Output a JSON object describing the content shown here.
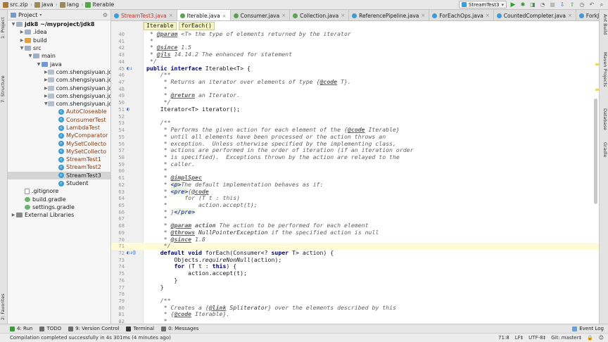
{
  "nav": {
    "crumbs": [
      "src.zip",
      "java",
      "lang",
      "Iterable"
    ],
    "run_config": "StreamTest3"
  },
  "left_toolbar": [
    "1: Project",
    "7: Structure",
    "2: Favorites"
  ],
  "right_toolbar": [
    "Ant Build",
    "Maven Projects",
    "Database",
    "Gradle"
  ],
  "project": {
    "title": "Project",
    "tree": [
      {
        "label": "jdk8 ~/myproject/jdk8",
        "depth": 0,
        "arrow": "▼",
        "icon": "folder",
        "bold": true
      },
      {
        "label": ".idea",
        "depth": 1,
        "arrow": "▶",
        "icon": "folder"
      },
      {
        "label": "build",
        "depth": 1,
        "arrow": "▶",
        "icon": "folder-orange"
      },
      {
        "label": "src",
        "depth": 1,
        "arrow": "▼",
        "icon": "folder"
      },
      {
        "label": "main",
        "depth": 2,
        "arrow": "▼",
        "icon": "folder"
      },
      {
        "label": "java",
        "depth": 3,
        "arrow": "▼",
        "icon": "folder-blue"
      },
      {
        "label": "com.shengsiyuan.jdk",
        "depth": 4,
        "arrow": "▶",
        "icon": "package"
      },
      {
        "label": "com.shengsiyuan.jdk",
        "depth": 4,
        "arrow": "▶",
        "icon": "package"
      },
      {
        "label": "com.shengsiyuan.jdk",
        "depth": 4,
        "arrow": "▶",
        "icon": "package"
      },
      {
        "label": "com.shengsiyuan.jdk",
        "depth": 4,
        "arrow": "▶",
        "icon": "package"
      },
      {
        "label": "com.shengsiyuan.jdk",
        "depth": 4,
        "arrow": "▼",
        "icon": "package"
      },
      {
        "label": "AutoCloseable",
        "depth": 5,
        "arrow": "",
        "icon": "class",
        "color": "#8a3b12"
      },
      {
        "label": "ConsumerTest",
        "depth": 5,
        "arrow": "",
        "icon": "class",
        "color": "#8a3b12"
      },
      {
        "label": "LambdaTest",
        "depth": 5,
        "arrow": "",
        "icon": "class",
        "color": "#8a3b12"
      },
      {
        "label": "MyComparator",
        "depth": 5,
        "arrow": "",
        "icon": "class",
        "color": "#8a3b12"
      },
      {
        "label": "MySetCollecto",
        "depth": 5,
        "arrow": "",
        "icon": "class",
        "color": "#8a3b12"
      },
      {
        "label": "MySetCollecto",
        "depth": 5,
        "arrow": "",
        "icon": "class",
        "color": "#8a3b12"
      },
      {
        "label": "StreamTest1",
        "depth": 5,
        "arrow": "",
        "icon": "class",
        "color": "#8a3b12"
      },
      {
        "label": "StreamTest2",
        "depth": 5,
        "arrow": "",
        "icon": "class",
        "color": "#8a3b12"
      },
      {
        "label": "StreamTest3",
        "depth": 5,
        "arrow": "",
        "icon": "class",
        "selected": true
      },
      {
        "label": "Student",
        "depth": 5,
        "arrow": "",
        "icon": "class"
      },
      {
        "label": ".gitignore",
        "depth": 1,
        "arrow": "",
        "icon": "file"
      },
      {
        "label": "build.gradle",
        "depth": 1,
        "arrow": "",
        "icon": "gradle"
      },
      {
        "label": "settings.gradle",
        "depth": 1,
        "arrow": "",
        "icon": "gradle"
      },
      {
        "label": "External Libraries",
        "depth": 0,
        "arrow": "▶",
        "icon": "library"
      }
    ]
  },
  "tabs": [
    {
      "label": "StreamTest3.java",
      "color": "#c0392b",
      "icon": "#3d9bd6"
    },
    {
      "label": "Iterable.java",
      "active": true,
      "color": "#1a1a1a",
      "icon": "#57a64a"
    },
    {
      "label": "Consumer.java",
      "color": "#1a1a1a",
      "icon": "#57a64a"
    },
    {
      "label": "Collection.java",
      "color": "#1a1a1a",
      "icon": "#57a64a"
    },
    {
      "label": "ReferencePipeline.java",
      "color": "#1a1a1a",
      "icon": "#3d9bd6"
    },
    {
      "label": "ForEachOps.java",
      "color": "#1a1a1a",
      "icon": "#3d9bd6"
    },
    {
      "label": "CountedCompleter.java",
      "color": "#1a1a1a",
      "icon": "#3d9bd6"
    },
    {
      "label": "ForkJoinTask.java",
      "color": "#1a1a1a",
      "icon": "#3d9bd6"
    }
  ],
  "editor_crumbs": [
    "Iterable",
    "forEach()"
  ],
  "code_lines": [
    {
      "n": "40",
      "html": "<span class=\"c-doc\"> * <span class=\"c-tag\">@param</span> &lt;T&gt; the type of elements returned by the iterator</span>"
    },
    {
      "n": "41",
      "html": "<span class=\"c-doc\"> *</span>"
    },
    {
      "n": "42",
      "html": "<span class=\"c-doc\"> * <span class=\"c-tag\">@since</span> 1.5</span>"
    },
    {
      "n": "43",
      "html": "<span class=\"c-doc\"> * <span class=\"c-tag\">@jls</span> 14.14.2 The enhanced for statement</span>"
    },
    {
      "n": "44",
      "html": "<span class=\"c-doc\"> */</span>"
    },
    {
      "n": "45",
      "mark": "◐↓",
      "html": "<span class=\"c-kw\">public interface</span> Iterable&lt;T&gt; {"
    },
    {
      "n": "46",
      "html": "    <span class=\"c-doc\">/**</span>"
    },
    {
      "n": "47",
      "html": "<span class=\"c-doc\">     * Returns an iterator over elements of type {<span class=\"c-tag\">@code</span> T}.</span>"
    },
    {
      "n": "48",
      "html": "<span class=\"c-doc\">     *</span>"
    },
    {
      "n": "49",
      "html": "<span class=\"c-doc\">     * <span class=\"c-tag\">@return</span> an Iterator.</span>"
    },
    {
      "n": "50",
      "html": "<span class=\"c-doc\">     */</span>"
    },
    {
      "n": "51",
      "mark": "◐",
      "html": "    Iterator&lt;T&gt; iterator();"
    },
    {
      "n": "52",
      "html": ""
    },
    {
      "n": "53",
      "html": "    <span class=\"c-doc\">/**</span>"
    },
    {
      "n": "54",
      "html": "<span class=\"c-doc\">     * Performs the given action for each element of the {<span class=\"c-tag\">@code</span> Iterable}</span>"
    },
    {
      "n": "55",
      "html": "<span class=\"c-doc\">     * until all elements have been processed or the action throws an</span>"
    },
    {
      "n": "56",
      "html": "<span class=\"c-doc\">     * exception.  Unless otherwise specified by the implementing class,</span>"
    },
    {
      "n": "57",
      "html": "<span class=\"c-doc\">     * actions are performed in the order of iteration (if an iteration order</span>"
    },
    {
      "n": "58",
      "html": "<span class=\"c-doc\">     * is specified).  Exceptions thrown by the action are relayed to the</span>"
    },
    {
      "n": "59",
      "html": "<span class=\"c-doc\">     * caller.</span>"
    },
    {
      "n": "60",
      "html": "<span class=\"c-doc\">     *</span>"
    },
    {
      "n": "61",
      "html": "<span class=\"c-doc\">     * <span class=\"c-tag\">@implSpec</span></span>"
    },
    {
      "n": "62",
      "html": "<span class=\"c-doc\">     * <span class=\"c-html\">&lt;p&gt;</span>The default implementation behaves as if:</span>"
    },
    {
      "n": "63",
      "html": "<span class=\"c-doc\">     * <span class=\"c-html\">&lt;pre&gt;</span>{<span class=\"c-tag\">@code</span></span>"
    },
    {
      "n": "64",
      "html": "<span class=\"c-doc\">     *     for (T t : this)</span>"
    },
    {
      "n": "65",
      "html": "<span class=\"c-doc\">     *         action.accept(t);</span>"
    },
    {
      "n": "66",
      "html": "<span class=\"c-doc\">     * }<span class=\"c-html\">&lt;/pre&gt;</span></span>"
    },
    {
      "n": "67",
      "html": "<span class=\"c-doc\">     *</span>"
    },
    {
      "n": "68",
      "html": "<span class=\"c-doc\">     * <span class=\"c-tag\">@param</span> <b>action</b> The action to be performed for each element</span>"
    },
    {
      "n": "69",
      "html": "<span class=\"c-doc\">     * <span class=\"c-tag\">@throws</span> <span class=\"c-ref\">NullPointerException</span> if the specified action is null</span>"
    },
    {
      "n": "70",
      "html": "<span class=\"c-doc\">     * <span class=\"c-tag\">@since</span> 1.8</span>"
    },
    {
      "n": "71",
      "html": "<span class=\"c-doc\">     */</span>",
      "cur": true
    },
    {
      "n": "72",
      "mark": "◐↓@",
      "html": "    <span class=\"c-kw\">default void</span> forEach(Consumer&lt;? <span class=\"c-kw\">super</span> T&gt; action) {"
    },
    {
      "n": "73",
      "html": "        Objects.<i>requireNonNull</i>(action);"
    },
    {
      "n": "74",
      "html": "        <span class=\"c-kw\">for</span> (T t : <span class=\"c-kw\">this</span>) {"
    },
    {
      "n": "75",
      "html": "            action.accept(t);"
    },
    {
      "n": "76",
      "html": "        }"
    },
    {
      "n": "77",
      "html": "    }"
    },
    {
      "n": "78",
      "html": ""
    },
    {
      "n": "79",
      "html": "    <span class=\"c-doc\">/**</span>"
    },
    {
      "n": "80",
      "html": "<span class=\"c-doc\">     * Creates a {<span class=\"c-tag\">@link</span> <span class=\"c-ref\">Spliterator</span>} over the elements described by this</span>"
    },
    {
      "n": "81",
      "html": "<span class=\"c-doc\">     * {<span class=\"c-tag\">@code</span> Iterable}.</span>"
    },
    {
      "n": "82",
      "html": "<span class=\"c-doc\">     *</span>"
    }
  ],
  "toolwindows": [
    {
      "label": "4: Run",
      "color": "#3c9a3c"
    },
    {
      "label": "TODO",
      "color": "#6a6a6a"
    },
    {
      "label": "9: Version Control",
      "color": "#6a6a6a"
    },
    {
      "label": "Terminal",
      "color": "#333333"
    },
    {
      "label": "0: Messages",
      "color": "#6a6a6a"
    }
  ],
  "event_log": "Event Log",
  "status": {
    "message": "Compilation completed successfully in 4s 301ms (4 minutes ago)",
    "position": "71:8",
    "line_sep": "LF‡",
    "encoding": "UTF-8‡",
    "vcs": "Git: master‡"
  }
}
